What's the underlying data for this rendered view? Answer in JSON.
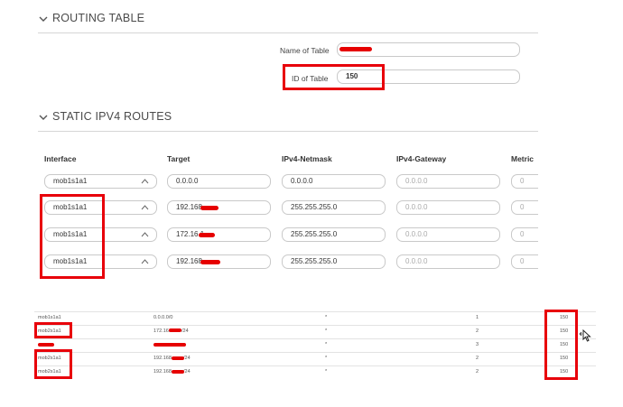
{
  "routing_table": {
    "title": "ROUTING TABLE",
    "name_label": "Name of Table",
    "name_value": "",
    "id_label": "ID of Table",
    "id_value": "150"
  },
  "static_routes": {
    "title": "STATIC IPV4 ROUTES",
    "columns": [
      "Interface",
      "Target",
      "IPv4-Netmask",
      "IPv4-Gateway",
      "Metric"
    ],
    "rows": [
      {
        "interface": "mob1s1a1",
        "target": "0.0.0.0",
        "netmask": "0.0.0.0",
        "gateway": "0.0.0.0",
        "metric": "0"
      },
      {
        "interface": "mob1s1a1",
        "target": "192.168.",
        "netmask": "255.255.255.0",
        "gateway": "0.0.0.0",
        "metric": "0"
      },
      {
        "interface": "mob1s1a1",
        "target": "172.16.1",
        "netmask": "255.255.255.0",
        "gateway": "0.0.0.0",
        "metric": "0"
      },
      {
        "interface": "mob1s1a1",
        "target": "192.168.",
        "netmask": "255.255.255.0",
        "gateway": "0.0.0.0",
        "metric": "0"
      }
    ]
  },
  "route_list": {
    "rows": [
      {
        "iface": "mob1s1a1",
        "dest": "0.0.0.0/0",
        "gw": "*",
        "metric": "1",
        "table": "150"
      },
      {
        "iface": "mob2s1a1",
        "dest": "172.16.",
        "dest_suffix": "/24",
        "gw": "*",
        "metric": "2",
        "table": "150"
      },
      {
        "iface": "",
        "dest": "",
        "gw": "*",
        "metric": "3",
        "table": "150"
      },
      {
        "iface": "mob2s1a1",
        "dest": "192.168.",
        "dest_suffix": "/24",
        "gw": "*",
        "metric": "2",
        "table": "150"
      },
      {
        "iface": "mob2s1a1",
        "dest": "192.168",
        "dest_suffix": "/24",
        "gw": "*",
        "metric": "2",
        "table": "150"
      }
    ]
  },
  "colors": {
    "highlight": "#e8000a",
    "redaction": "#e60000"
  }
}
